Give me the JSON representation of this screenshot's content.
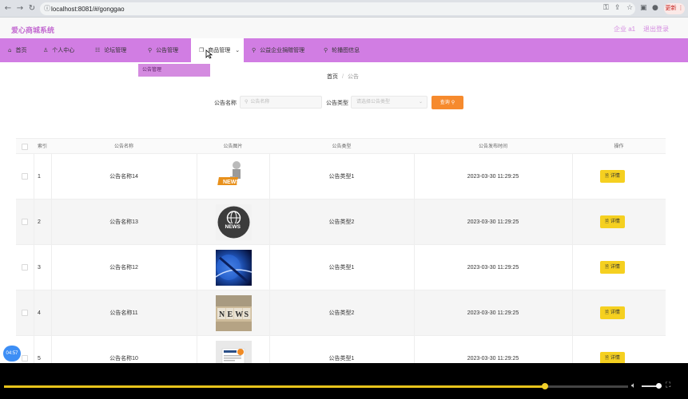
{
  "browser": {
    "url": "localhost:8081/#/gonggao",
    "update_label": "更新",
    "icons": [
      "back-icon",
      "forward-icon",
      "reload-icon",
      "key-icon",
      "share-icon",
      "star-icon",
      "sidebar-icon",
      "profile-icon",
      "menu-icon"
    ]
  },
  "header": {
    "brand": "爱心商城系统",
    "user": "企业 a1",
    "logout": "退出登录"
  },
  "nav": {
    "items": [
      {
        "label": "首页",
        "icon": "home-icon"
      },
      {
        "label": "个人中心",
        "icon": "user-icon"
      },
      {
        "label": "论坛管理",
        "icon": "forum-icon"
      },
      {
        "label": "公告管理",
        "icon": "notice-icon"
      },
      {
        "label": "商品管理",
        "icon": "goods-icon",
        "active": true,
        "caret": "⌄"
      },
      {
        "label": "公益企业捐赠管理",
        "icon": "donation-icon"
      },
      {
        "label": "轮播图信息",
        "icon": "carousel-icon"
      }
    ],
    "submenu": [
      "公告管理"
    ]
  },
  "breadcrumb": {
    "home": "首页",
    "separator": "/",
    "current": "公告"
  },
  "search": {
    "name_label": "公告名称",
    "name_placeholder": "公告名称",
    "type_label": "公告类型",
    "type_placeholder": "请选择公告类型",
    "query_button": "查询"
  },
  "table": {
    "headers": [
      "索引",
      "公告名称",
      "公告图片",
      "公告类型",
      "公告发布时间",
      "操作"
    ],
    "detail_label": "详情",
    "rows": [
      {
        "index": "1",
        "name": "公告名称14",
        "image": "news-figure-image",
        "type": "公告类型1",
        "time": "2023-03-30 11:29:25"
      },
      {
        "index": "2",
        "name": "公告名称13",
        "image": "news-globe-image",
        "type": "公告类型2",
        "time": "2023-03-30 11:29:25"
      },
      {
        "index": "3",
        "name": "公告名称12",
        "image": "news-blue-screen-image",
        "type": "公告类型1",
        "time": "2023-03-30 11:29:25"
      },
      {
        "index": "4",
        "name": "公告名称11",
        "image": "news-blocks-image",
        "type": "公告类型2",
        "time": "2023-03-30 11:29:25"
      },
      {
        "index": "5",
        "name": "公告名称10",
        "image": "news-paper-image",
        "type": "公告类型1",
        "time": "2023-03-30 11:29:25"
      }
    ]
  },
  "overlay": {
    "timer": "04:57",
    "playback_progress": 0.867,
    "volume_level": 0.85
  },
  "colors": {
    "brand": "#c36ad1",
    "nav_bg": "#d17de3",
    "query_button": "#f68a2d",
    "detail_button": "#f5d020",
    "progress": "#e8c41b"
  }
}
